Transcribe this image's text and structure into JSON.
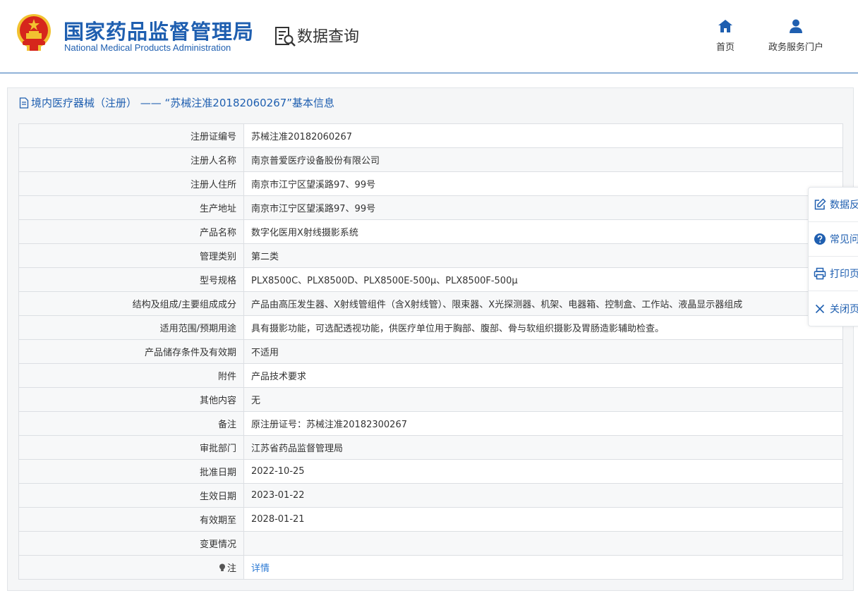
{
  "header": {
    "org_name_cn": "国家药品监督管理局",
    "org_name_en": "National Medical Products Administration",
    "section_title": "数据查询",
    "nav": [
      {
        "label": "首页",
        "icon": "home-icon"
      },
      {
        "label": "政务服务门户",
        "icon": "user-icon"
      }
    ]
  },
  "panel": {
    "title": "境内医疗器械（注册） —— “苏械注准20182060267”基本信息"
  },
  "table": {
    "rows": [
      {
        "label": "注册证编号",
        "value": "苏械注准20182060267"
      },
      {
        "label": "注册人名称",
        "value": "南京普爱医疗设备股份有限公司"
      },
      {
        "label": "注册人住所",
        "value": "南京市江宁区望溪路97、99号"
      },
      {
        "label": "生产地址",
        "value": "南京市江宁区望溪路97、99号"
      },
      {
        "label": "产品名称",
        "value": "数字化医用X射线摄影系统"
      },
      {
        "label": "管理类别",
        "value": "第二类"
      },
      {
        "label": "型号规格",
        "value": "PLX8500C、PLX8500D、PLX8500E-500μ、PLX8500F-500μ"
      },
      {
        "label": "结构及组成/主要组成成分",
        "value": "产品由高压发生器、X射线管组件（含X射线管）、限束器、X光探测器、机架、电器箱、控制盒、工作站、液晶显示器组成"
      },
      {
        "label": "适用范围/预期用途",
        "value": "具有摄影功能，可选配透视功能，供医疗单位用于胸部、腹部、骨与软组织摄影及胃肠造影辅助检查。"
      },
      {
        "label": "产品储存条件及有效期",
        "value": "不适用"
      },
      {
        "label": "附件",
        "value": "产品技术要求"
      },
      {
        "label": "其他内容",
        "value": "无"
      },
      {
        "label": "备注",
        "value": "原注册证号：苏械注准20182300267"
      },
      {
        "label": "审批部门",
        "value": "江苏省药品监督管理局"
      },
      {
        "label": "批准日期",
        "value": "2022-10-25"
      },
      {
        "label": "生效日期",
        "value": "2023-01-22"
      },
      {
        "label": "有效期至",
        "value": "2028-01-21"
      },
      {
        "label": "变更情况",
        "value": ""
      }
    ],
    "note_row": {
      "label": "注",
      "icon": "lightbulb-icon",
      "link": "详情"
    }
  },
  "sidebar": {
    "items": [
      {
        "label": "数据反",
        "icon": "edit-icon"
      },
      {
        "label": "常见问",
        "icon": "help-icon"
      },
      {
        "label": "打印页",
        "icon": "print-icon"
      },
      {
        "label": "关闭页",
        "icon": "close-icon"
      }
    ]
  },
  "colors": {
    "brand_blue": "#1f5fb0",
    "link_blue": "#2e7bd4",
    "emblem_red": "#d6261c",
    "emblem_gold": "#f2c230"
  }
}
